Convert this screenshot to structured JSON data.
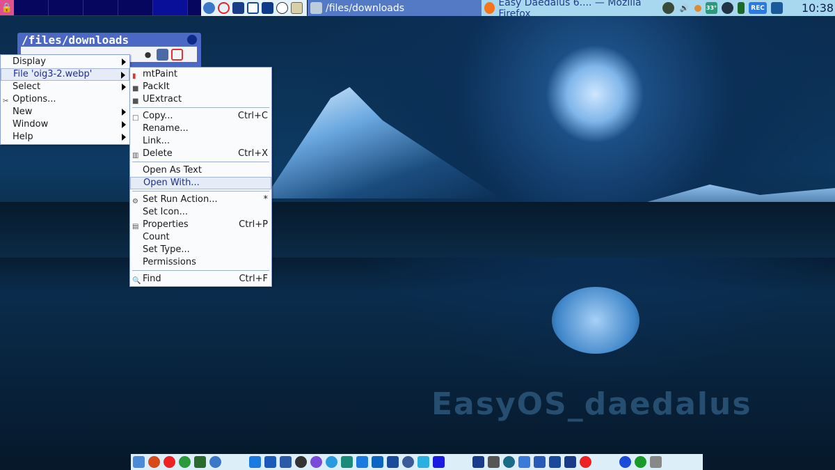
{
  "top_panel": {
    "workspace_count": 6,
    "active_workspace": 6,
    "launchers": [
      "browser-icon",
      "opera-icon",
      "sd-card-icon",
      "file-icon",
      "trash-icon",
      "chat-icon",
      "drive-icon"
    ],
    "tasks": [
      {
        "label": "/files/downloads",
        "icon": "folder-icon",
        "active": true
      },
      {
        "label": "Easy Daedalus 6.... — Mozilla Firefox",
        "icon": "firefox-icon",
        "active": false
      }
    ],
    "tray": [
      "user-icon",
      "volume-icon",
      "sun-icon",
      "temperature-icon",
      "network-icon",
      "battery-icon",
      "record-icon",
      "camera-icon"
    ],
    "temperature": "33°",
    "rec_label": "REC",
    "clock": "10:38"
  },
  "file_window": {
    "title": "/files/downloads"
  },
  "main_menu": [
    {
      "label": "Display",
      "submenu": true
    },
    {
      "label": "File 'oig3-2.webp'",
      "submenu": true,
      "highlighted": true
    },
    {
      "label": "Select",
      "submenu": true
    },
    {
      "label": "Options...",
      "icon": "options-icon"
    },
    {
      "label": "New",
      "submenu": true
    },
    {
      "label": "Window",
      "submenu": true
    },
    {
      "label": "Help",
      "submenu": true
    }
  ],
  "file_submenu": {
    "apps": [
      {
        "label": "mtPaint"
      },
      {
        "label": "PackIt"
      },
      {
        "label": "UExtract"
      }
    ],
    "ops": [
      {
        "label": "Copy...",
        "shortcut": "Ctrl+C"
      },
      {
        "label": "Rename..."
      },
      {
        "label": "Link..."
      },
      {
        "label": "Delete",
        "shortcut": "Ctrl+X"
      }
    ],
    "open": [
      {
        "label": "Open As Text"
      },
      {
        "label": "Open With..."
      }
    ],
    "props": [
      {
        "label": "Set Run Action...",
        "shortcut": "*"
      },
      {
        "label": "Set Icon..."
      },
      {
        "label": "Properties",
        "shortcut": "Ctrl+P"
      },
      {
        "label": "Count"
      },
      {
        "label": "Set Type..."
      },
      {
        "label": "Permissions"
      }
    ],
    "find": {
      "label": "Find",
      "shortcut": "Ctrl+F"
    }
  },
  "wallpaper": {
    "watermark": "EasyOS_daedalus"
  },
  "dock": [
    "finder-icon",
    "firefox-icon",
    "opera-icon",
    "chrome-icon",
    "gecko-icon",
    "browser-icon",
    "mail-icon",
    "window-icon",
    "rss-icon",
    "settings-icon",
    "viber-icon",
    "telegram-icon",
    "chatgpt-icon",
    "app-icon",
    "linkedin-icon",
    "globe-icon",
    "x-icon",
    "instagram-icon",
    "tiktok-icon",
    "grid-icon",
    "gimp-icon",
    "amazon-icon",
    "youtube-icon",
    "word-icon",
    "editor-icon",
    "terminal-icon",
    "restart-icon",
    "target-icon",
    "power-icon",
    "sleep-icon"
  ]
}
